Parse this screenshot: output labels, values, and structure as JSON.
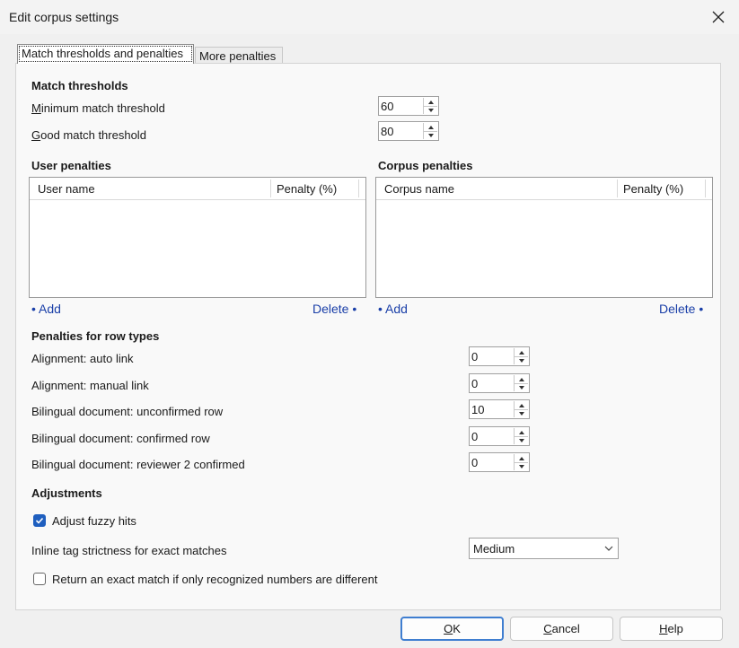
{
  "window": {
    "title": "Edit corpus settings"
  },
  "tabs": [
    {
      "label": "Match thresholds and penalties"
    },
    {
      "label": "More penalties"
    }
  ],
  "match_thresholds": {
    "heading": "Match thresholds",
    "minimum": {
      "label_first": "M",
      "label_rest": "inimum match threshold",
      "value": "60"
    },
    "good": {
      "label_first": "G",
      "label_rest": "ood match threshold",
      "value": "80"
    }
  },
  "user_penalties": {
    "heading": "User penalties",
    "columns": [
      "User name",
      "Penalty (%)"
    ],
    "add": "Add",
    "delete": "Delete"
  },
  "corpus_penalties": {
    "heading": "Corpus penalties",
    "columns": [
      "Corpus name",
      "Penalty (%)"
    ],
    "add": "Add",
    "delete": "Delete"
  },
  "row_types": {
    "heading": "Penalties for row types",
    "items": [
      {
        "label": "Alignment: auto link",
        "value": "0"
      },
      {
        "label": "Alignment: manual link",
        "value": "0"
      },
      {
        "label": "Bilingual document: unconfirmed row",
        "value": "10"
      },
      {
        "label": "Bilingual document: confirmed row",
        "value": "0"
      },
      {
        "label": "Bilingual document: reviewer 2 confirmed",
        "value": "0"
      }
    ]
  },
  "adjustments": {
    "heading": "Adjustments",
    "adjust_fuzzy": {
      "label": "Adjust fuzzy hits",
      "checked": true
    },
    "inline_tag": {
      "label": "Inline tag strictness for exact matches",
      "value": "Medium"
    },
    "exact_numbers": {
      "label": "Return an exact match if only recognized numbers are different",
      "checked": false
    }
  },
  "buttons": {
    "ok_first": "O",
    "ok_rest": "K",
    "cancel_first": "C",
    "cancel_rest": "ancel",
    "help_first": "H",
    "help_rest": "elp"
  },
  "icons": {
    "close": "close-icon",
    "check": "check-icon",
    "chevron": "chevron-down-icon"
  },
  "colors": {
    "link": "#1a3fa8",
    "accent": "#1f5fbf"
  }
}
